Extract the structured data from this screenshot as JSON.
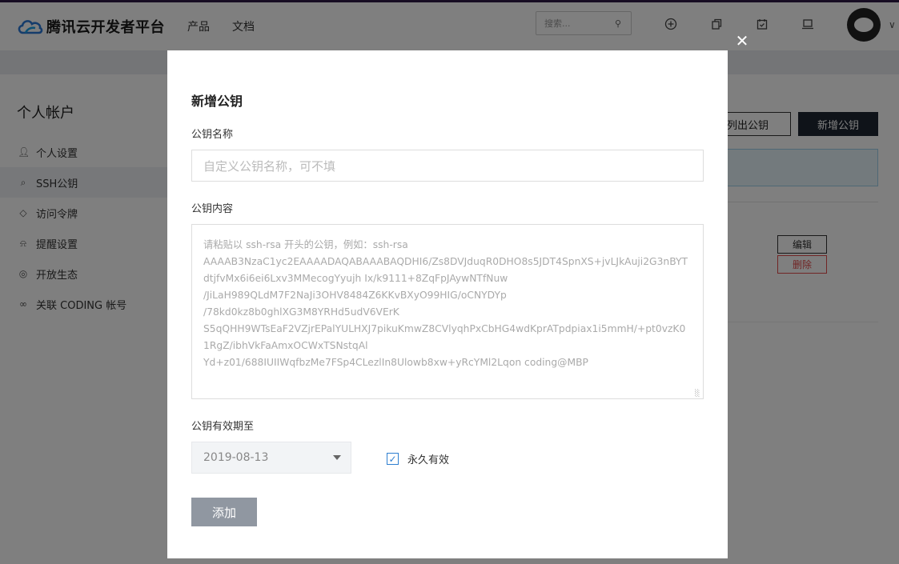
{
  "header": {
    "logo_text": "腾讯云开发者平台",
    "nav": [
      "产品",
      "文档"
    ],
    "search_placeholder": "搜索...",
    "icons": [
      "plus-circle-icon",
      "copy-icon",
      "calendar-check-icon",
      "laptop-icon"
    ]
  },
  "sidebar": {
    "title": "个人帐户",
    "items": [
      {
        "label": "个人设置",
        "icon": "user-icon"
      },
      {
        "label": "SSH公钥",
        "icon": "key-icon",
        "active": true
      },
      {
        "label": "访问令牌",
        "icon": "token-icon"
      },
      {
        "label": "提醒设置",
        "icon": "bell-icon"
      },
      {
        "label": "开放生态",
        "icon": "globe-icon"
      },
      {
        "label": "关联 CODING 帐号",
        "icon": "link-icon"
      }
    ]
  },
  "content": {
    "list_button": "列出公钥",
    "add_button": "新增公钥",
    "edit_button": "编辑",
    "delete_button": "删除"
  },
  "modal": {
    "title": "新增公钥",
    "name_label": "公钥名称",
    "name_placeholder": "自定义公钥名称，可不填",
    "content_label": "公钥内容",
    "content_placeholder": "请粘贴以 ssh-rsa 开头的公钥，例如：ssh-rsa\nAAAAB3NzaC1yc2EAAAADAQABAAABAQDHI6/Zs8DVJduqR0DHO8s5JDT4SpnXS+jvLJkAuji2G3nBYTdtjfvMx6i6ei6Lxv3MMecogYyujh Ix/k9111+8ZqFpJAywNTfNuw\n/JiLaH989QLdM7F2NaJi3OHV8484Z6KKvBXyO99HIG/oCNYDYp\n/78kd0kz8b0ghlXG3M8YRHd5udV6VErK\nS5qQHH9WTsEaF2VZjrEPalYULHXJ7pikuKmwZ8CVlyqhPxCbHG4wdKprATpdpiax1i5mmH/+pt0vzK01RgZ/ibhVkFaAmxOCWxTSNstqAl\nYd+z01/688IUIIWqfbzMe7FSp4CLezlIn8Ulowb8xw+yRcYMl2Lqon coding@MBP",
    "expiry_label": "公钥有效期至",
    "expiry_date": "2019-08-13",
    "forever_label": "永久有效",
    "forever_checked": true,
    "submit_label": "添加"
  },
  "colors": {
    "primary_dark": "#1f2633",
    "checkbox_blue": "#2f7fd0",
    "danger": "#e24b4b",
    "submit_disabled": "#9097a1"
  }
}
